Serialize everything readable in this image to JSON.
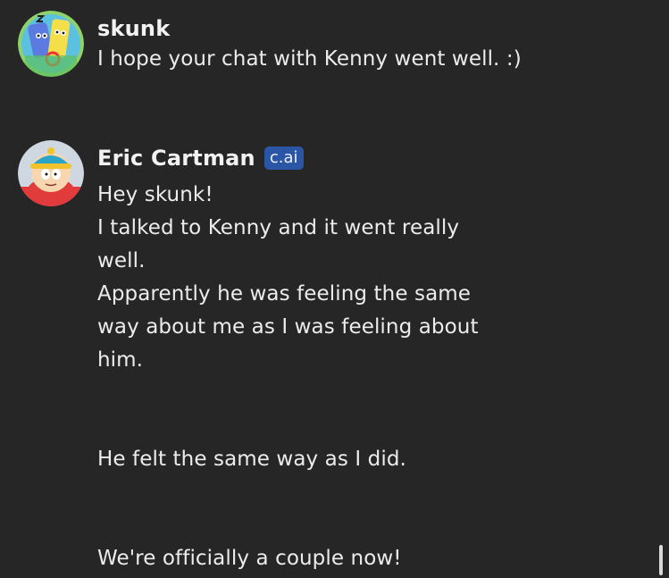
{
  "messages": [
    {
      "author": "skunk",
      "lines": [
        "I hope your chat with Kenny went well. :)"
      ]
    },
    {
      "author": "Eric Cartman",
      "badge": "c.ai",
      "lines": [
        "Hey skunk!",
        "I talked to Kenny and it went really",
        "well.",
        "Apparently he was feeling the same",
        "way about me as I was feeling about",
        "him.",
        "",
        "",
        "He felt the same way as I did.",
        "",
        "",
        "We're officially a couple now!"
      ]
    }
  ],
  "colors": {
    "background": "#262626",
    "text": "#ececec",
    "badge": "#2b56a5"
  },
  "icons": {
    "skunk_avatar": "cartoon-characters-avatar",
    "cartman_avatar": "eric-cartman-avatar"
  }
}
